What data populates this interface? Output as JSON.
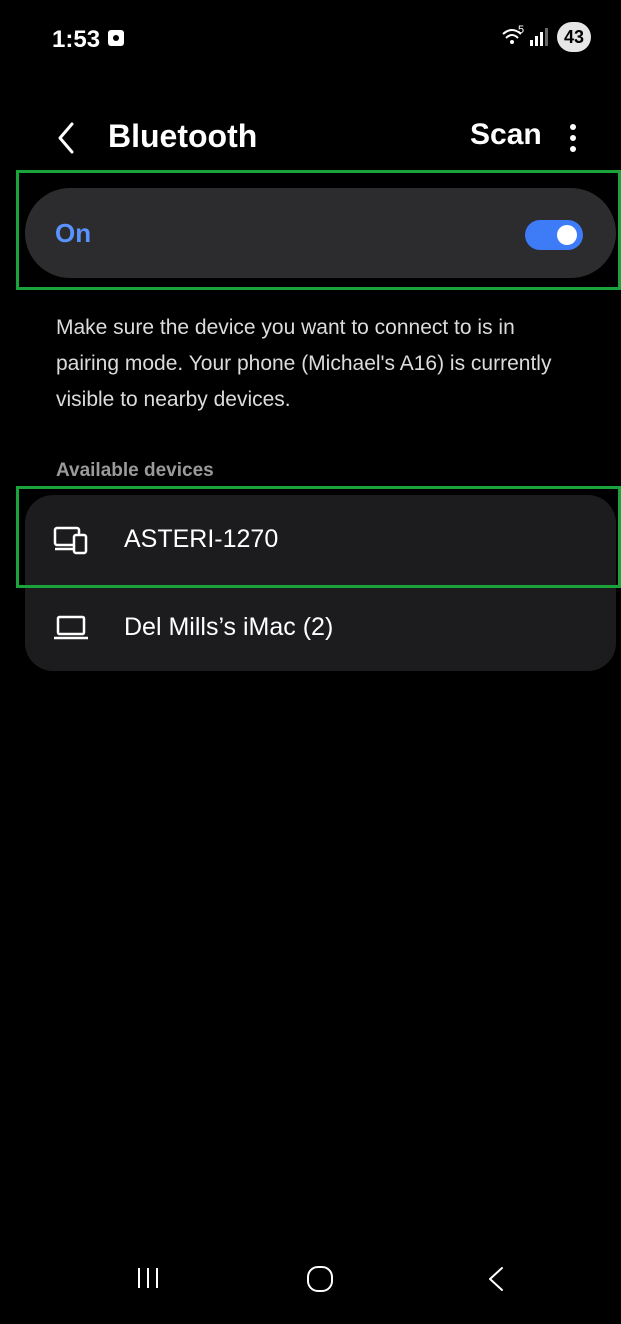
{
  "status_bar": {
    "time": "1:53",
    "wifi_label": "5",
    "battery": "43"
  },
  "header": {
    "title": "Bluetooth",
    "scan_label": "Scan"
  },
  "toggle": {
    "label": "On",
    "state": "on",
    "accent_color": "#3e7bf7"
  },
  "description": "Make sure the device you want to connect to is in pairing mode. Your phone (Michael's A16) is currently visible to nearby devices.",
  "available_devices": {
    "header": "Available devices",
    "items": [
      {
        "label": "ASTERI-1270",
        "icon": "phone-and-monitor-icon"
      },
      {
        "label": "Del Mills’s iMac (2)",
        "icon": "laptop-icon"
      }
    ]
  },
  "highlight_color": "#1aa33a"
}
